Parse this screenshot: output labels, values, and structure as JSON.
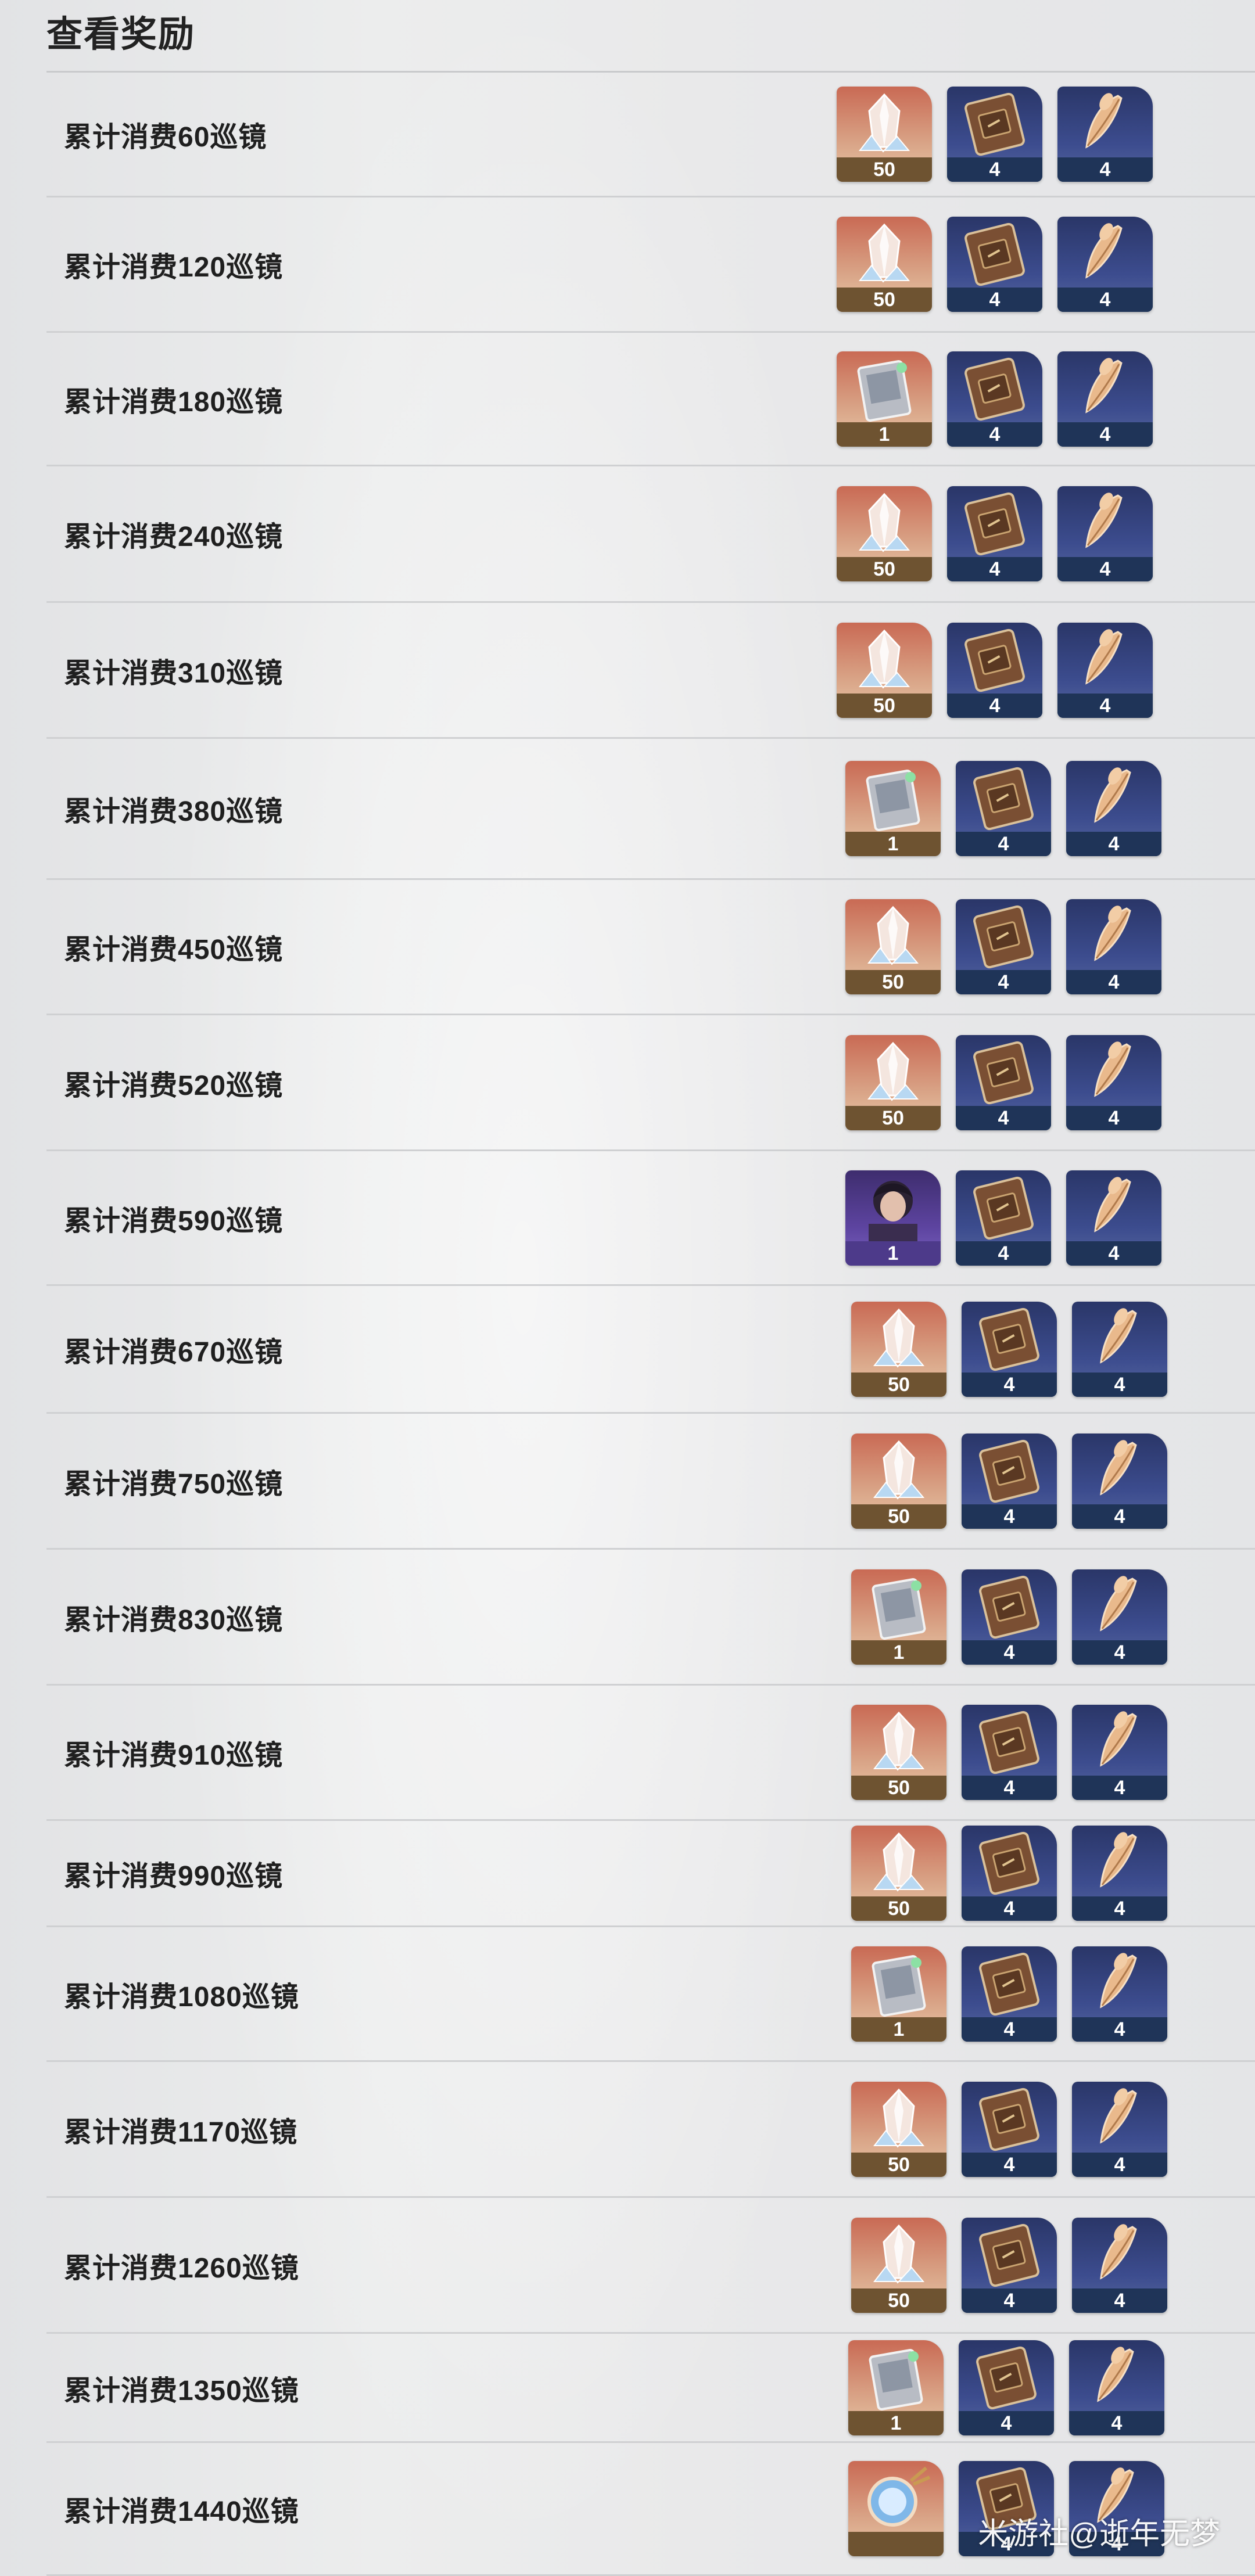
{
  "page": {
    "title": "查看奖励",
    "watermark": "米游社@逝年无梦"
  },
  "rewards": [
    {
      "label": "累计消费60巡镜",
      "items": [
        {
          "icon": "crystal-icon",
          "count": "50",
          "tier": "orange"
        },
        {
          "icon": "book-icon",
          "count": "4",
          "tier": "blue"
        },
        {
          "icon": "feather-icon",
          "count": "4",
          "tier": "blue"
        }
      ]
    },
    {
      "label": "累计消费120巡镜",
      "items": [
        {
          "icon": "crystal-icon",
          "count": "50",
          "tier": "orange"
        },
        {
          "icon": "book-icon",
          "count": "4",
          "tier": "blue"
        },
        {
          "icon": "feather-icon",
          "count": "4",
          "tier": "blue"
        }
      ]
    },
    {
      "label": "累计消费180巡镜",
      "items": [
        {
          "icon": "ticket-icon",
          "count": "1",
          "tier": "orange"
        },
        {
          "icon": "book-icon",
          "count": "4",
          "tier": "blue"
        },
        {
          "icon": "feather-icon",
          "count": "4",
          "tier": "blue"
        }
      ]
    },
    {
      "label": "累计消费240巡镜",
      "items": [
        {
          "icon": "crystal-icon",
          "count": "50",
          "tier": "orange"
        },
        {
          "icon": "book-icon",
          "count": "4",
          "tier": "blue"
        },
        {
          "icon": "feather-icon",
          "count": "4",
          "tier": "blue"
        }
      ]
    },
    {
      "label": "累计消费310巡镜",
      "items": [
        {
          "icon": "crystal-icon",
          "count": "50",
          "tier": "orange"
        },
        {
          "icon": "book-icon",
          "count": "4",
          "tier": "blue"
        },
        {
          "icon": "feather-icon",
          "count": "4",
          "tier": "blue"
        }
      ]
    },
    {
      "label": "累计消费380巡镜",
      "items": [
        {
          "icon": "ticket-icon",
          "count": "1",
          "tier": "orange"
        },
        {
          "icon": "book-icon",
          "count": "4",
          "tier": "blue"
        },
        {
          "icon": "feather-icon",
          "count": "4",
          "tier": "blue"
        }
      ]
    },
    {
      "label": "累计消费450巡镜",
      "items": [
        {
          "icon": "crystal-icon",
          "count": "50",
          "tier": "orange"
        },
        {
          "icon": "book-icon",
          "count": "4",
          "tier": "blue"
        },
        {
          "icon": "feather-icon",
          "count": "4",
          "tier": "blue"
        }
      ]
    },
    {
      "label": "累计消费520巡镜",
      "items": [
        {
          "icon": "crystal-icon",
          "count": "50",
          "tier": "orange"
        },
        {
          "icon": "book-icon",
          "count": "4",
          "tier": "blue"
        },
        {
          "icon": "feather-icon",
          "count": "4",
          "tier": "blue"
        }
      ]
    },
    {
      "label": "累计消费590巡镜",
      "items": [
        {
          "icon": "character-portrait-icon",
          "count": "1",
          "tier": "purple"
        },
        {
          "icon": "book-icon",
          "count": "4",
          "tier": "blue"
        },
        {
          "icon": "feather-icon",
          "count": "4",
          "tier": "blue"
        }
      ]
    },
    {
      "label": "累计消费670巡镜",
      "items": [
        {
          "icon": "crystal-icon",
          "count": "50",
          "tier": "orange"
        },
        {
          "icon": "book-icon",
          "count": "4",
          "tier": "blue"
        },
        {
          "icon": "feather-icon",
          "count": "4",
          "tier": "blue"
        }
      ]
    },
    {
      "label": "累计消费750巡镜",
      "items": [
        {
          "icon": "crystal-icon",
          "count": "50",
          "tier": "orange"
        },
        {
          "icon": "book-icon",
          "count": "4",
          "tier": "blue"
        },
        {
          "icon": "feather-icon",
          "count": "4",
          "tier": "blue"
        }
      ]
    },
    {
      "label": "累计消费830巡镜",
      "items": [
        {
          "icon": "ticket-icon",
          "count": "1",
          "tier": "orange"
        },
        {
          "icon": "book-icon",
          "count": "4",
          "tier": "blue"
        },
        {
          "icon": "feather-icon",
          "count": "4",
          "tier": "blue"
        }
      ]
    },
    {
      "label": "累计消费910巡镜",
      "items": [
        {
          "icon": "crystal-icon",
          "count": "50",
          "tier": "orange"
        },
        {
          "icon": "book-icon",
          "count": "4",
          "tier": "blue"
        },
        {
          "icon": "feather-icon",
          "count": "4",
          "tier": "blue"
        }
      ]
    },
    {
      "label": "累计消费990巡镜",
      "items": [
        {
          "icon": "crystal-icon",
          "count": "50",
          "tier": "orange"
        },
        {
          "icon": "book-icon",
          "count": "4",
          "tier": "blue"
        },
        {
          "icon": "feather-icon",
          "count": "4",
          "tier": "blue"
        }
      ]
    },
    {
      "label": "累计消费1080巡镜",
      "items": [
        {
          "icon": "ticket-icon",
          "count": "1",
          "tier": "orange"
        },
        {
          "icon": "book-icon",
          "count": "4",
          "tier": "blue"
        },
        {
          "icon": "feather-icon",
          "count": "4",
          "tier": "blue"
        }
      ]
    },
    {
      "label": "累计消费1170巡镜",
      "items": [
        {
          "icon": "crystal-icon",
          "count": "50",
          "tier": "orange"
        },
        {
          "icon": "book-icon",
          "count": "4",
          "tier": "blue"
        },
        {
          "icon": "feather-icon",
          "count": "4",
          "tier": "blue"
        }
      ]
    },
    {
      "label": "累计消费1260巡镜",
      "items": [
        {
          "icon": "crystal-icon",
          "count": "50",
          "tier": "orange"
        },
        {
          "icon": "book-icon",
          "count": "4",
          "tier": "blue"
        },
        {
          "icon": "feather-icon",
          "count": "4",
          "tier": "blue"
        }
      ]
    },
    {
      "label": "累计消费1350巡镜",
      "items": [
        {
          "icon": "ticket-icon",
          "count": "1",
          "tier": "orange"
        },
        {
          "icon": "book-icon",
          "count": "4",
          "tier": "blue"
        },
        {
          "icon": "feather-icon",
          "count": "4",
          "tier": "blue"
        }
      ]
    },
    {
      "label": "累计消费1440巡镜",
      "items": [
        {
          "icon": "compass-orb-icon",
          "count": "",
          "tier": "orange"
        },
        {
          "icon": "book-icon",
          "count": "4",
          "tier": "blue"
        },
        {
          "icon": "feather-icon",
          "count": "4",
          "tier": "blue"
        }
      ]
    }
  ]
}
